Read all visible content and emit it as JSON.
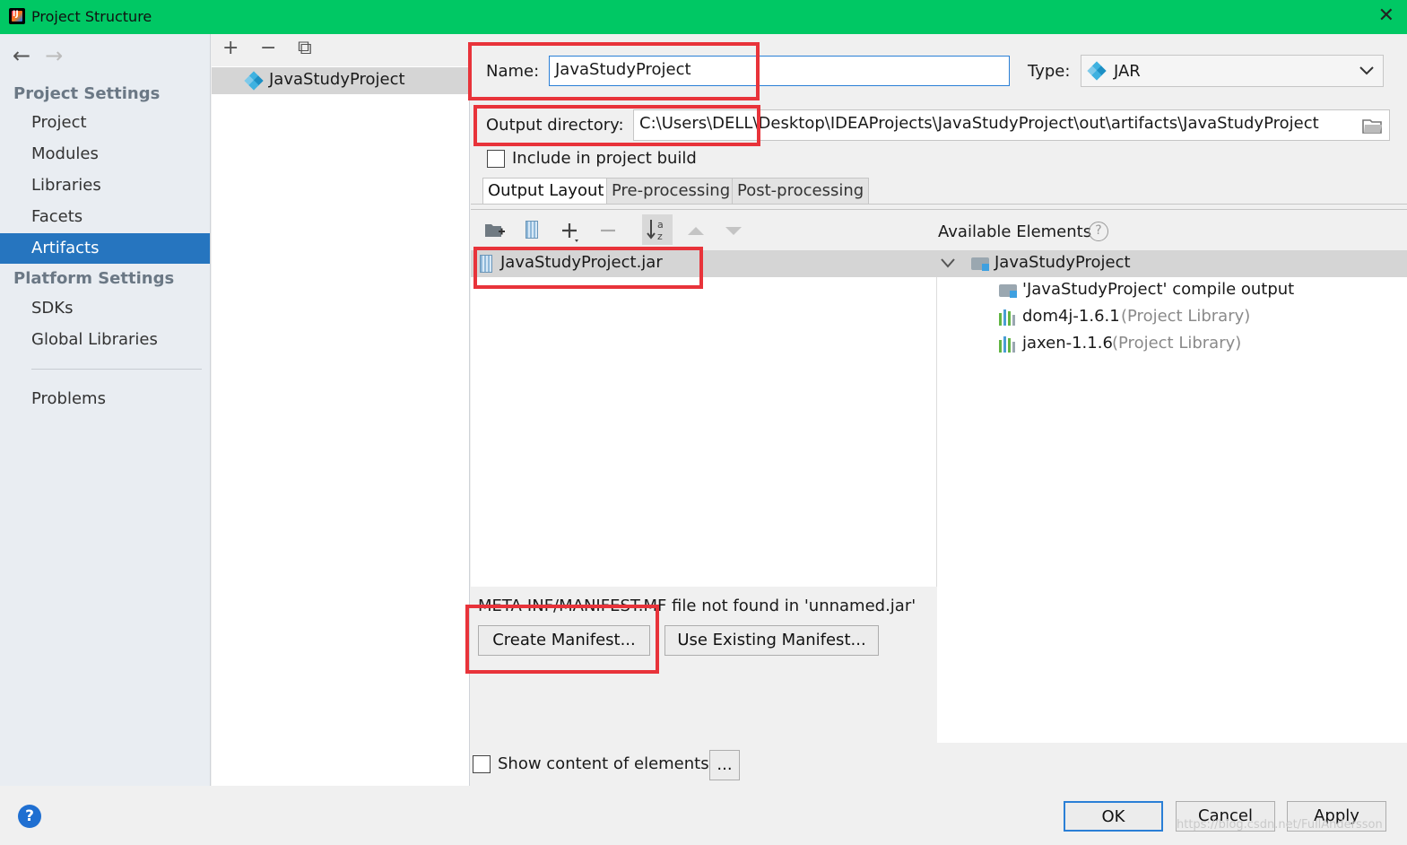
{
  "window": {
    "title": "Project Structure",
    "close_glyph": "✕"
  },
  "nav": {
    "back_glyph": "←",
    "forward_glyph": "→",
    "project_settings_header": "Project Settings",
    "project_items": [
      "Project",
      "Modules",
      "Libraries",
      "Facets",
      "Artifacts"
    ],
    "platform_settings_header": "Platform Settings",
    "platform_items": [
      "SDKs",
      "Global Libraries"
    ],
    "problems": "Problems",
    "selected": "Artifacts"
  },
  "artifacts_list": {
    "toolbar": {
      "add": "+",
      "remove": "−",
      "copy": "⧉"
    },
    "items": [
      "JavaStudyProject"
    ]
  },
  "artifact": {
    "name_label": "Name:",
    "name_value": "JavaStudyProject",
    "type_label": "Type:",
    "type_value": "JAR",
    "output_dir_label": "Output directory:",
    "output_dir_value": "C:\\Users\\DELL\\Desktop\\IDEAProjects\\JavaStudyProject\\out\\artifacts\\JavaStudyProject",
    "include_in_build_label": "Include in project build",
    "include_in_build_checked": false,
    "tabs": [
      "Output Layout",
      "Pre-processing",
      "Post-processing"
    ],
    "active_tab": "Output Layout"
  },
  "layout": {
    "toolbar_icons": [
      "new-folder-icon",
      "archive-icon",
      "add-icon",
      "remove-icon",
      "sort-icon",
      "move-up-icon",
      "move-down-icon"
    ],
    "tree_items": [
      "JavaStudyProject.jar"
    ],
    "available_header": "Available Elements",
    "available_help": "?",
    "available": {
      "root": "JavaStudyProject",
      "children": [
        {
          "label": "'JavaStudyProject' compile output",
          "suffix": ""
        },
        {
          "label": "dom4j-1.6.1",
          "suffix": "(Project Library)"
        },
        {
          "label": "jaxen-1.1.6",
          "suffix": "(Project Library)"
        }
      ]
    },
    "manifest_message": "META-INF/MANIFEST.MF file not found in 'unnamed.jar'",
    "create_manifest": "Create Manifest...",
    "use_existing_manifest": "Use Existing Manifest...",
    "show_content_label": "Show content of elements",
    "show_content_checked": false,
    "ellipsis": "..."
  },
  "footer": {
    "help": "?",
    "ok": "OK",
    "cancel": "Cancel",
    "apply": "Apply",
    "watermark": "https://blog.csdn.net/FullAndersson"
  },
  "colors": {
    "titlebar": "#00c864",
    "selection": "#2675bf",
    "highlight_box": "#e8333a",
    "primary_border": "#2a7fd6"
  }
}
